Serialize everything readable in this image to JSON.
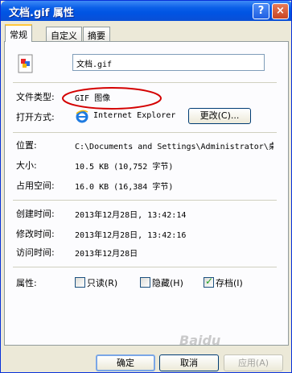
{
  "window": {
    "title": "文档.gif 属性",
    "help_label": "?",
    "close_label": "×"
  },
  "tabs": [
    {
      "label": "常规"
    },
    {
      "label": "自定义"
    },
    {
      "label": "摘要"
    }
  ],
  "general": {
    "filename": "文档.gif",
    "file_type_label": "文件类型:",
    "file_type_value": "GIF 图像",
    "opens_with_label": "打开方式:",
    "opens_with_value": "Internet Explorer",
    "change_button": "更改(C)...",
    "location_label": "位置:",
    "location_value": "C:\\Documents and Settings\\Administrator\\桌",
    "size_label": "大小:",
    "size_value": "10.5 KB (10,752 字节)",
    "disk_size_label": "占用空间:",
    "disk_size_value": "16.0 KB (16,384 字节)",
    "created_label": "创建时间:",
    "created_value": "2013年12月28日, 13:42:14",
    "modified_label": "修改时间:",
    "modified_value": "2013年12月28日, 13:42:16",
    "accessed_label": "访问时间:",
    "accessed_value": "2013年12月28日",
    "attributes_label": "属性:",
    "attributes": [
      {
        "label": "只读(R)",
        "checked": false
      },
      {
        "label": "隐藏(H)",
        "checked": false
      },
      {
        "label": "存档(I)",
        "checked": true
      }
    ]
  },
  "buttons": {
    "ok": "确定",
    "cancel": "取消",
    "apply": "应用(A)"
  },
  "annotation_color": "#d40000",
  "watermark": "Baidu"
}
